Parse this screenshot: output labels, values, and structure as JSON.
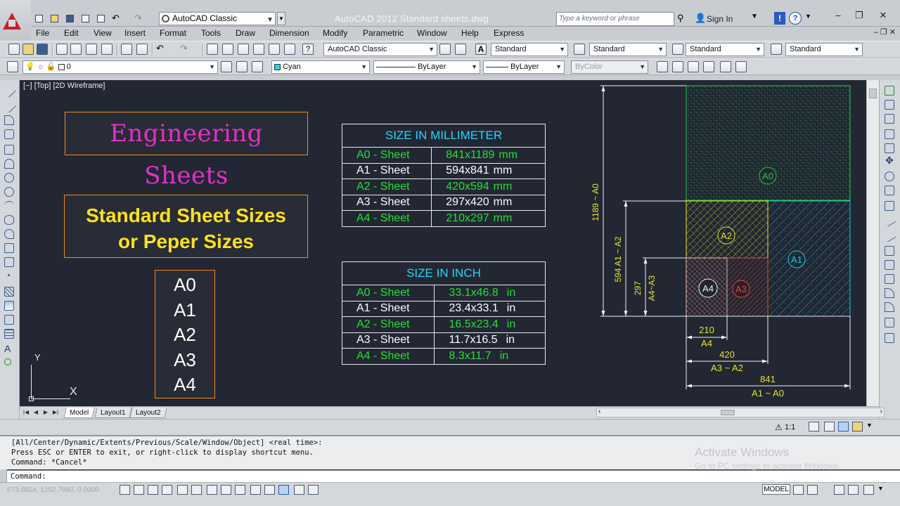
{
  "window": {
    "title": "AutoCAD 2012    Standard sheets.dwg",
    "workspace": "AutoCAD Classic",
    "search_placeholder": "Type a keyword or phrase",
    "sign_in": "Sign In",
    "minimize": "–",
    "restore": "❐",
    "close": "✕",
    "mdi_controls": "–  ❐  ✕",
    "colors": {
      "titlebar": "#c9ccd1",
      "canvas": "#222733",
      "accent_logo": "#c8202a"
    }
  },
  "menu": [
    "File",
    "Edit",
    "View",
    "Insert",
    "Format",
    "Tools",
    "Draw",
    "Dimension",
    "Modify",
    "Parametric",
    "Window",
    "Help",
    "Express"
  ],
  "toolbar": {
    "workspace_combo": "AutoCAD Classic",
    "text_style": "Standard",
    "dim_style": "Standard",
    "table_style": "Standard",
    "multileader_style": "Standard",
    "layer": "0",
    "color": "Cyan",
    "linetype": "ByLayer",
    "lineweight": "ByLayer",
    "plot_style": "ByColor"
  },
  "viewport_label": "[−] [Top] [2D Wireframe]",
  "drawing": {
    "title": "Engineering Sheets",
    "subtitle_line1": "Standard Sheet Sizes",
    "subtitle_line2": "or Peper Sizes",
    "sizes": [
      "A0",
      "A1",
      "A2",
      "A3",
      "A4"
    ],
    "table_mm": {
      "header": "SIZE IN MILLIMETER",
      "rows": [
        {
          "sheet": "A0 - Sheet",
          "size": "841x1189",
          "unit": "mm",
          "highlight": true
        },
        {
          "sheet": "A1 - Sheet",
          "size": "594x841",
          "unit": "mm",
          "highlight": false
        },
        {
          "sheet": "A2 - Sheet",
          "size": "420x594",
          "unit": "mm",
          "highlight": true
        },
        {
          "sheet": "A3 - Sheet",
          "size": "297x420",
          "unit": "mm",
          "highlight": false
        },
        {
          "sheet": "A4 - Sheet",
          "size": "210x297",
          "unit": "mm",
          "highlight": true
        }
      ]
    },
    "table_inch": {
      "header": "SIZE IN INCH",
      "rows": [
        {
          "sheet": "A0 - Sheet",
          "size": "33.1x46.8",
          "unit": "in",
          "highlight": true
        },
        {
          "sheet": "A1 - Sheet",
          "size": "23.4x33.1",
          "unit": "in",
          "highlight": false
        },
        {
          "sheet": "A2 - Sheet",
          "size": "16.5x23.4",
          "unit": "in",
          "highlight": true
        },
        {
          "sheet": "A3 - Sheet",
          "size": "11.7x16.5",
          "unit": "in",
          "highlight": false
        },
        {
          "sheet": "A4 - Sheet",
          "size": "8.3x11.7",
          "unit": "in",
          "highlight": true
        }
      ]
    },
    "diagram": {
      "labels": {
        "a0": "A0",
        "a1": "A1",
        "a2": "A2",
        "a3": "A3",
        "a4": "A4"
      },
      "dims": {
        "v_1189": "1189 ~ A0",
        "v_594": "594  A1 ~ A2",
        "v_297": "297",
        "v_a4a3": "A4~A3",
        "h_210": "210",
        "h_210_sub": "A4",
        "h_420": "420",
        "h_420_sub": "A3 ~ A2",
        "h_841": "841",
        "h_841_sub": "A1 ~ A0"
      }
    },
    "ucs": {
      "x": "X",
      "y": "Y"
    }
  },
  "layout_tabs": [
    "Model",
    "Layout1",
    "Layout2"
  ],
  "annotation_scale": "1:1",
  "command": {
    "history": [
      "[All/Center/Dynamic/Extents/Previous/Scale/Window/Object] <real time>:",
      "Press ESC or ENTER to exit, or right-click to display shortcut menu.",
      "Command: *Cancel*"
    ],
    "prompt": "Command:"
  },
  "watermark": {
    "line1": "Activate Windows",
    "line2": "Go to PC settings to activate Windows."
  },
  "status": {
    "coords": "673.0824, 1292.7980, 0.0000",
    "model": "MODEL"
  }
}
